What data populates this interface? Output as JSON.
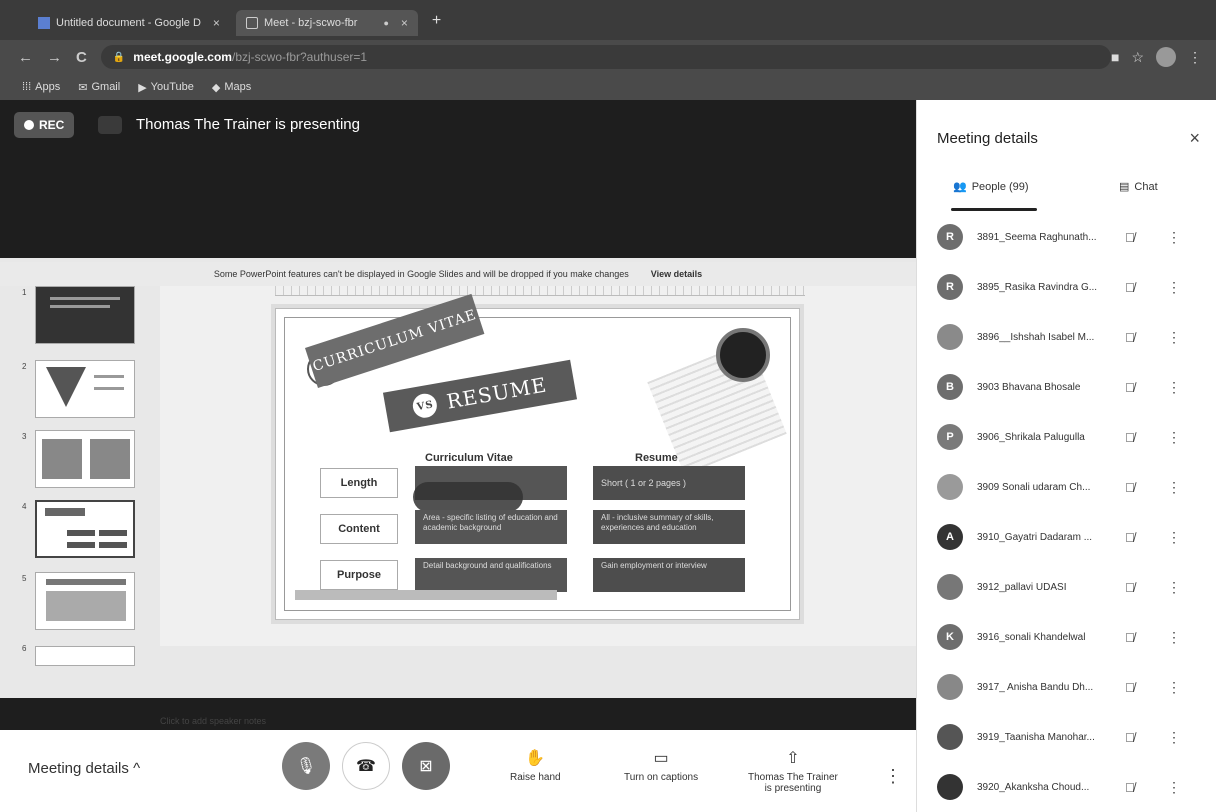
{
  "browser": {
    "tabs": [
      {
        "label": "Untitled document - Google D",
        "close": "×"
      },
      {
        "label": "Meet - bzj-scwo-fbr",
        "close": "×"
      }
    ],
    "new_tab": "+",
    "url_host": "meet.google.com",
    "url_path": "/bzj-scwo-fbr?authuser=1",
    "bookmarks": [
      "Apps",
      "Gmail",
      "YouTube",
      "Maps"
    ]
  },
  "stage": {
    "rec_label": "REC",
    "presenting_text": "Thomas The Trainer is presenting"
  },
  "slides_editor": {
    "warning": "Some PowerPoint features can't be displayed in Google Slides and will be dropped if you make changes",
    "view_details": "View details",
    "speaker_notes": "Click to add speaker notes",
    "thumb_numbers": [
      "1",
      "2",
      "3",
      "4",
      "5",
      "6"
    ]
  },
  "slide": {
    "ribbon1": "CURRICULUM VITAE",
    "vs": "VS",
    "ribbon2": "RESUME",
    "col1": "Curriculum Vitae",
    "col2": "Resume",
    "rows": [
      {
        "label": "Length",
        "cv": "",
        "resume": "Short ( 1 or 2 pages )"
      },
      {
        "label": "Content",
        "cv": "Area - specific listing of education and academic background",
        "resume": "All - inclusive summary of skills, experiences and education"
      },
      {
        "label": "Purpose",
        "cv": "Detail background and qualifications",
        "resume": "Gain employment or interview"
      }
    ]
  },
  "panel": {
    "title": "Meeting details",
    "close": "×",
    "tab_people": "People (99)",
    "tab_chat": "Chat",
    "people": [
      {
        "initial": "R",
        "name": "3891_Seema Raghunath...",
        "color": "#6e6e6e"
      },
      {
        "initial": "R",
        "name": "3895_Rasika Ravindra G...",
        "color": "#6e6e6e"
      },
      {
        "initial": "",
        "name": "3896__Ishshah Isabel M...",
        "color": "#8a8a8a"
      },
      {
        "initial": "B",
        "name": "3903 Bhavana Bhosale",
        "color": "#6e6e6e"
      },
      {
        "initial": "P",
        "name": "3906_Shrikala Palugulla",
        "color": "#7a7a7a"
      },
      {
        "initial": "",
        "name": "3909 Sonali udaram Ch...",
        "color": "#9a9a9a"
      },
      {
        "initial": "A",
        "name": "3910_Gayatri Dadaram ...",
        "color": "#333333"
      },
      {
        "initial": "",
        "name": "3912_pallavi UDASI",
        "color": "#777777"
      },
      {
        "initial": "K",
        "name": "3916_sonali Khandelwal",
        "color": "#6e6e6e"
      },
      {
        "initial": "",
        "name": "3917_ Anisha Bandu Dh...",
        "color": "#888888"
      },
      {
        "initial": "",
        "name": "3919_Taanisha Manohar...",
        "color": "#555555"
      },
      {
        "initial": "",
        "name": "3920_Akanksha Choud...",
        "color": "#333333"
      }
    ]
  },
  "bottom": {
    "meeting_details": "Meeting details",
    "raise_hand": "Raise hand",
    "captions": "Turn on captions",
    "presenting_line1": "Thomas The Trainer",
    "presenting_line2": "is presenting"
  }
}
